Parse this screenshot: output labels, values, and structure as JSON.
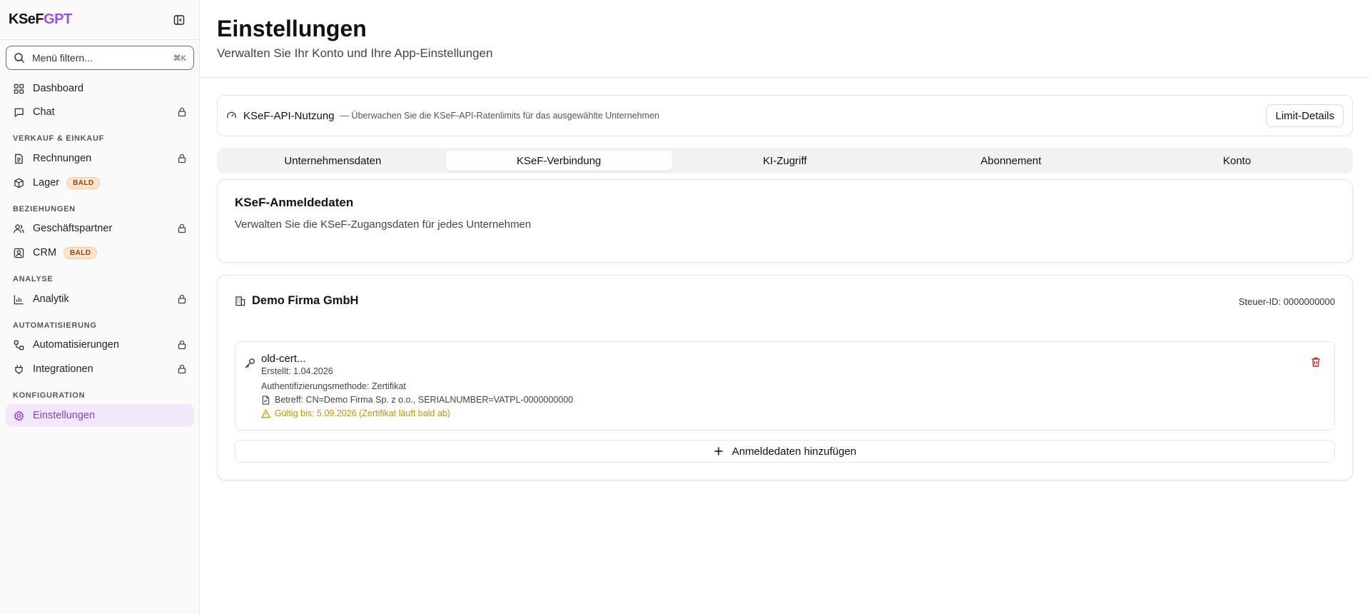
{
  "logo": {
    "part1": "KSeF",
    "part2": "GPT"
  },
  "sidebar": {
    "filter_placeholder": "Menü filtern...",
    "filter_shortcut": "⌘K",
    "items": [
      {
        "label": "Dashboard"
      },
      {
        "label": "Chat"
      },
      {
        "label": "Rechnungen"
      },
      {
        "label": "Lager",
        "badge": "BALD"
      },
      {
        "label": "Geschäftspartner"
      },
      {
        "label": "CRM",
        "badge": "BALD"
      },
      {
        "label": "Analytik"
      },
      {
        "label": "Automatisierungen"
      },
      {
        "label": "Integrationen"
      },
      {
        "label": "Einstellungen"
      }
    ],
    "sections": [
      "VERKAUF & EINKAUF",
      "BEZIEHUNGEN",
      "ANALYSE",
      "AUTOMATISIERUNG",
      "KONFIGURATION"
    ]
  },
  "header": {
    "title": "Einstellungen",
    "subtitle": "Verwalten Sie Ihr Konto und Ihre App-Einstellungen"
  },
  "api_usage": {
    "title": "KSeF-API-Nutzung",
    "description": "— Überwachen Sie die KSeF-API-Ratenlimits für das ausgewählte Unternehmen",
    "button": "Limit-Details"
  },
  "tabs": [
    {
      "label": "Unternehmensdaten"
    },
    {
      "label": "KSeF-Verbindung"
    },
    {
      "label": "KI-Zugriff"
    },
    {
      "label": "Abonnement"
    },
    {
      "label": "Konto"
    }
  ],
  "credentials": {
    "title": "KSeF-Anmeldedaten",
    "description": "Verwalten Sie die KSeF-Zugangsdaten für jedes Unternehmen"
  },
  "company": {
    "name": "Demo Firma GmbH",
    "tax_id": "Steuer-ID: 0000000000",
    "certificate": {
      "name": "old-cert...",
      "created": "Erstellt: 1.04.2026",
      "auth_method": "Authentifizierungsmethode:  Zertifikat",
      "subject": "Betreff: CN=Demo Firma Sp. z o.o., SERIALNUMBER=VATPL-0000000000",
      "valid_until": "Gültig bis: 5.09.2026 (Zertifikat läuft bald ab)"
    },
    "add_button": "Anmeldedaten hinzufügen"
  },
  "colors": {
    "accent": "#9b51e0",
    "warning": "#c79300",
    "danger": "#c62828"
  }
}
